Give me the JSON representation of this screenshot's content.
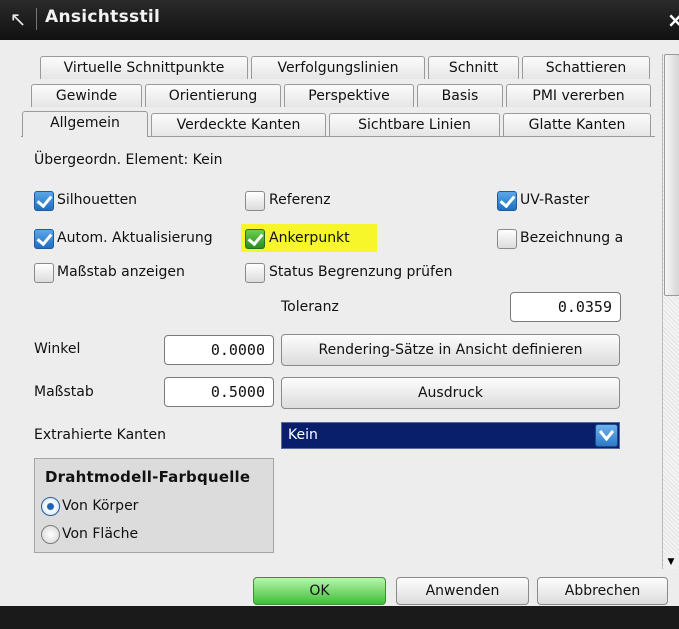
{
  "window": {
    "title": "Ansichtsstil",
    "close_glyph": "×"
  },
  "tabs_row1": [
    "Virtuelle Schnittpunkte",
    "Verfolgungslinien",
    "Schnitt",
    "Schattieren"
  ],
  "tabs_row2": [
    "Gewinde",
    "Orientierung",
    "Perspektive",
    "Basis",
    "PMI vererben"
  ],
  "tabs_row3": [
    "Allgemein",
    "Verdeckte Kanten",
    "Sichtbare Linien",
    "Glatte Kanten"
  ],
  "active_tab": "Allgemein",
  "parent_label": "Übergeordn. Element: Kein",
  "checkboxes": {
    "silhouetten": {
      "label": "Silhouetten",
      "checked": true
    },
    "referenz": {
      "label": "Referenz",
      "checked": false
    },
    "uv_raster": {
      "label": "UV-Raster",
      "checked": true
    },
    "autom": {
      "label": "Autom. Aktualisierung",
      "checked": true
    },
    "ankerpunkt": {
      "label": "Ankerpunkt",
      "checked": true,
      "highlight": "#f6f62a"
    },
    "bezeichnung": {
      "label": "Bezeichnung a",
      "checked": false
    },
    "massstab_anzeigen": {
      "label": "Maßstab anzeigen",
      "checked": false
    },
    "status": {
      "label": "Status Begrenzung prüfen",
      "checked": false
    }
  },
  "toleranz": {
    "label": "Toleranz",
    "value": "0.0359"
  },
  "winkel": {
    "label": "Winkel",
    "value": "0.0000"
  },
  "massstab": {
    "label": "Maßstab",
    "value": "0.5000"
  },
  "buttons": {
    "rendering": "Rendering-Sätze in Ansicht definieren",
    "ausdruck": "Ausdruck",
    "ok": "OK",
    "anwenden": "Anwenden",
    "abbrechen": "Abbrechen"
  },
  "extrahierte": {
    "label": "Extrahierte Kanten",
    "value": "Kein"
  },
  "farbquelle": {
    "title": "Drahtmodell-Farbquelle",
    "options": [
      "Von Körper",
      "Von Fläche"
    ],
    "selected": "Von Körper"
  },
  "colors": {
    "title_bg": "#1a1a1a",
    "combo_bg": "#0a1f6b",
    "ok_green": "#3fbe37",
    "check_blue": "#1f6fc2"
  }
}
